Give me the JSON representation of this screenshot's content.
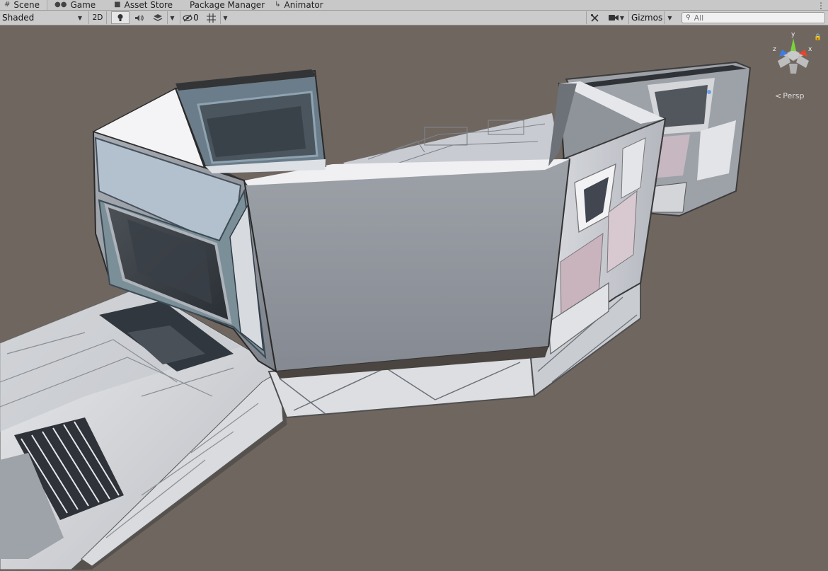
{
  "tabs": [
    {
      "label": "Scene",
      "icon": "scene-grid-icon"
    },
    {
      "label": "Game",
      "icon": "gamepad-icon"
    },
    {
      "label": "Asset Store",
      "icon": "bag-icon"
    },
    {
      "label": "Package Manager",
      "icon": "package-icon"
    },
    {
      "label": "Animator",
      "icon": "animator-icon"
    }
  ],
  "toolbar": {
    "draw_mode": "Shaded",
    "mode_2d": "2D",
    "hidden_count": "0",
    "gizmos_label": "Gizmos",
    "search_placeholder": "All"
  },
  "scene_view": {
    "projection_label": "Persp",
    "axes": {
      "y": "y",
      "x": "x",
      "z": "z"
    }
  },
  "colors": {
    "tabbar_bg": "#c8c8c8",
    "scene_bg": "#6f6660",
    "axis_x": "#e8432c",
    "axis_y": "#7bd23a",
    "axis_z": "#3a7de8"
  }
}
